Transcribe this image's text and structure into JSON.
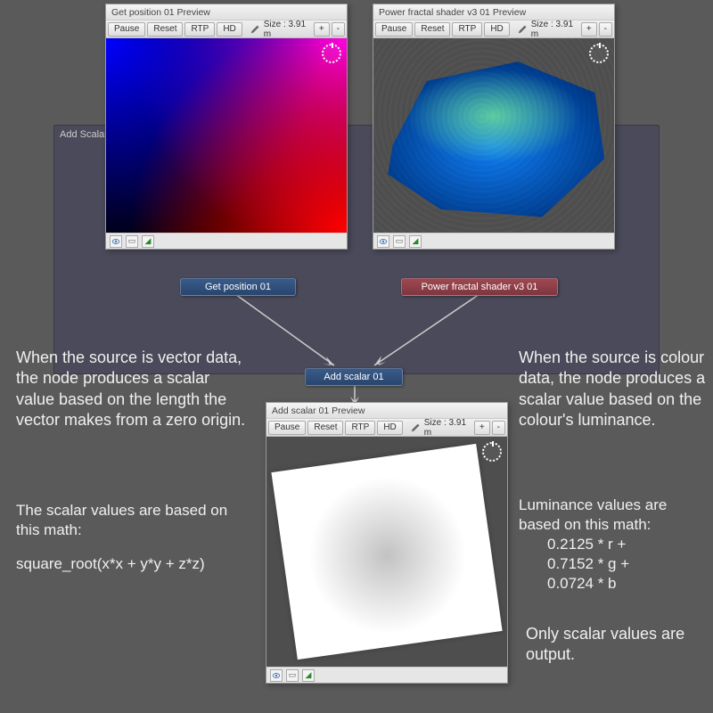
{
  "background_node": {
    "title": "Add Scalar"
  },
  "previews": {
    "get_position": {
      "title": "Get position 01 Preview",
      "pause": "Pause",
      "reset": "Reset",
      "rtp": "RTP",
      "hd": "HD",
      "size": "Size : 3.91 m",
      "plus": "+",
      "minus": "-"
    },
    "power_fractal": {
      "title": "Power fractal shader v3 01 Preview",
      "pause": "Pause",
      "reset": "Reset",
      "rtp": "RTP",
      "hd": "HD",
      "size": "Size : 3.91 m",
      "plus": "+",
      "minus": "-"
    },
    "add_scalar": {
      "title": "Add scalar 01 Preview",
      "pause": "Pause",
      "reset": "Reset",
      "rtp": "RTP",
      "hd": "HD",
      "size": "Size : 3.91 m",
      "plus": "+",
      "minus": "-"
    }
  },
  "nodes": {
    "get_position": "Get position 01",
    "power_fractal": "Power fractal shader v3 01",
    "add_scalar": "Add scalar 01"
  },
  "annotations": {
    "left1": "When the source is vector data, the node produces a scalar value based on the length the vector makes from a zero origin.",
    "left2": "The scalar values are based on this math:",
    "left3": "square_root(x*x + y*y + z*z)",
    "right1": "When the source is colour data, the node produces a scalar value based on the colour's luminance.",
    "right2": "Luminance values are based on this math:",
    "right2a": "0.2125 * r +",
    "right2b": "0.7152 * g +",
    "right2c": "0.0724 * b",
    "right3": "Only scalar values are output."
  }
}
